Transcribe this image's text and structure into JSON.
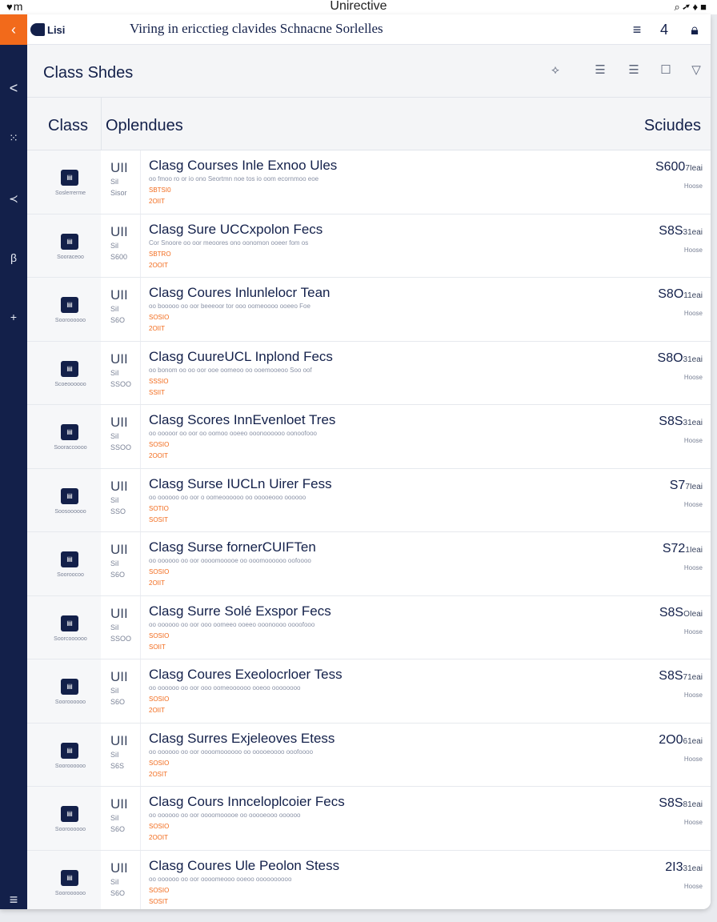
{
  "status_bar": {
    "left": "m",
    "center": "Unirective",
    "right_icons": [
      "search-icon",
      "location-icon",
      "signal-icon",
      "battery-icon"
    ]
  },
  "app_bar": {
    "back_icon": "chevron-left-icon",
    "brand": "Lisi",
    "title": "Viring in ericctieg clavides Schnacne Sorlelles",
    "icons": [
      "menu-icon",
      "notification-icon",
      "lock-icon"
    ]
  },
  "rail": {
    "items": [
      {
        "icon": "chevron-left-icon",
        "glyph": "<"
      },
      {
        "icon": "grid-icon",
        "glyph": "⁙"
      },
      {
        "icon": "code-icon",
        "glyph": "≺"
      },
      {
        "icon": "book-icon",
        "glyph": "β"
      },
      {
        "icon": "plus-icon",
        "glyph": "+"
      },
      {
        "icon": "menu-icon",
        "glyph": "≡"
      }
    ]
  },
  "page_header": {
    "title": "Class Shdes",
    "icons": [
      "pin-icon",
      "list-icon",
      "list-icon",
      "checkbox-icon",
      "filter-icon"
    ]
  },
  "table": {
    "headers": {
      "col1": "Class",
      "col2": "Oplendues",
      "col3": "Sciudes"
    },
    "rows": [
      {
        "code": "Soslerrerme",
        "unit": "UII",
        "unit_sub1": "Sil",
        "unit_sub2": "Sisor",
        "course": "Clasg Courses Inle Exnoo Ules",
        "desc": "oo fmoo ro or io ono Seortmn noe tos io oom ecornmoo eoe",
        "accent1": "SBTSI0",
        "accent2": "2OIIT",
        "price": "S600",
        "price_small": "7Ieai",
        "price_sub": "Hoose"
      },
      {
        "code": "Sooraceoo",
        "unit": "UII",
        "unit_sub1": "Sil",
        "unit_sub2": "S600",
        "course": "Clasg Sure UCCxpolon Fecs",
        "desc": "Cor Snoore oo oor meoores ono oonomon ooeer fom os",
        "accent1": "SBTRO",
        "accent2": "2OOIT",
        "price": "S8S",
        "price_small": "31eai",
        "price_sub": "Hoose"
      },
      {
        "code": "Sooroooooo",
        "unit": "UII",
        "unit_sub1": "SiI",
        "unit_sub2": "S6O",
        "course": "Clasg Coures Inlunlelocr Tean",
        "desc": "oo booooo oo oor beeeoor tor ooo oomeoooo ooeeo Foe",
        "accent1": "SOSIO",
        "accent2": "2OIIT",
        "price": "S8O",
        "price_small": "11eai",
        "price_sub": "Hoose"
      },
      {
        "code": "Scoeoooooo",
        "unit": "UII",
        "unit_sub1": "SiI",
        "unit_sub2": "SSOO",
        "course": "Clasg CuureUCL Inplond Fecs",
        "desc": "oo bonom oo oo oor ooe oomeoo oo ooemooeoo Soo oof",
        "accent1": "SSSIO",
        "accent2": "SSIIT",
        "price": "S8O",
        "price_small": "31eai",
        "price_sub": "Hoose"
      },
      {
        "code": "Sooraccoooo",
        "unit": "UII",
        "unit_sub1": "SiI",
        "unit_sub2": "SSOO",
        "course": "Clasg Scores InnEvenloet Tres",
        "desc": "oo ooooor oo oor oo oomoo ooeeo ooonoooooo oonoofooo",
        "accent1": "SOSIO",
        "accent2": "2OOIT",
        "price": "S8S",
        "price_small": "31eai",
        "price_sub": "Hoose"
      },
      {
        "code": "Soosoooooo",
        "unit": "UII",
        "unit_sub1": "SiI",
        "unit_sub2": "SSO",
        "course": "Clasg Surse IUCLn Uirer Fess",
        "desc": "oo oooooo oo oor o oomeoooooo oo ooooeooo oooooo",
        "accent1": "SOTIO",
        "accent2": "SOSIT",
        "price": "S7",
        "price_small": "7Ieai",
        "price_sub": "Hoose"
      },
      {
        "code": "Sooroocoo",
        "unit": "UII",
        "unit_sub1": "SiI",
        "unit_sub2": "S6O",
        "course": "Clasg Surse fornerCUIFTen",
        "desc": "oo oooooo oo oor oooomooooe oo ooomoooooo oofoooo",
        "accent1": "SOSIO",
        "accent2": "2OIIT",
        "price": "S72",
        "price_small": "1Ieai",
        "price_sub": "Hoose"
      },
      {
        "code": "Soorcoooooo",
        "unit": "UII",
        "unit_sub1": "SiI",
        "unit_sub2": "SSOO",
        "course": "Clasg Surre Solé Exspor Fecs",
        "desc": "oo oooooo oo oor ooo oomeeo ooeeo ooonoooo oooofooo",
        "accent1": "SOSIO",
        "accent2": "SOIIT",
        "price": "S8S",
        "price_small": "OIeai",
        "price_sub": "Hoose"
      },
      {
        "code": "Sooroooooo",
        "unit": "UII",
        "unit_sub1": "SiI",
        "unit_sub2": "S6O",
        "course": "Clasg Coures Exeolocrloer Tess",
        "desc": "oo oooooo oo oor ooo oomeoooooo ooeoo oooooooo",
        "accent1": "SOSIO",
        "accent2": "2OIIT",
        "price": "S8S",
        "price_small": "71eai",
        "price_sub": "Hoose"
      },
      {
        "code": "Sooroooooo",
        "unit": "UII",
        "unit_sub1": "SiI",
        "unit_sub2": "S6S",
        "course": "Clasg Surres Exjeleoves Etess",
        "desc": "oo oooooo oo oor oooomoooooo oo ooooeoooo ooofoooo",
        "accent1": "SOSIO",
        "accent2": "2OSIT",
        "price": "2O0",
        "price_small": "61eai",
        "price_sub": "Hoose"
      },
      {
        "code": "Sooroooooo",
        "unit": "UII",
        "unit_sub1": "SiI",
        "unit_sub2": "S6O",
        "course": "Clasg Cours Innceloplcoier Fecs",
        "desc": "oo oooooo oo oor oooomooooe oo ooooeooo oooooo",
        "accent1": "SOSIO",
        "accent2": "2OOIT",
        "price": "S8S",
        "price_small": "81eai",
        "price_sub": "Hoose"
      },
      {
        "code": "Sooroooooo",
        "unit": "UII",
        "unit_sub1": "SiI",
        "unit_sub2": "S6O",
        "course": "Clasg Coures Ule Peolon Stess",
        "desc": "oo oooooo oo oor oooomeooo ooeoo oooooooooo",
        "accent1": "SOSIO",
        "accent2": "SOSIT",
        "price": "2I3",
        "price_small": "31eai",
        "price_sub": "Hoose"
      }
    ]
  },
  "colors": {
    "navy": "#13204a",
    "accent": "#f26a1b",
    "muted": "#7a8296"
  }
}
